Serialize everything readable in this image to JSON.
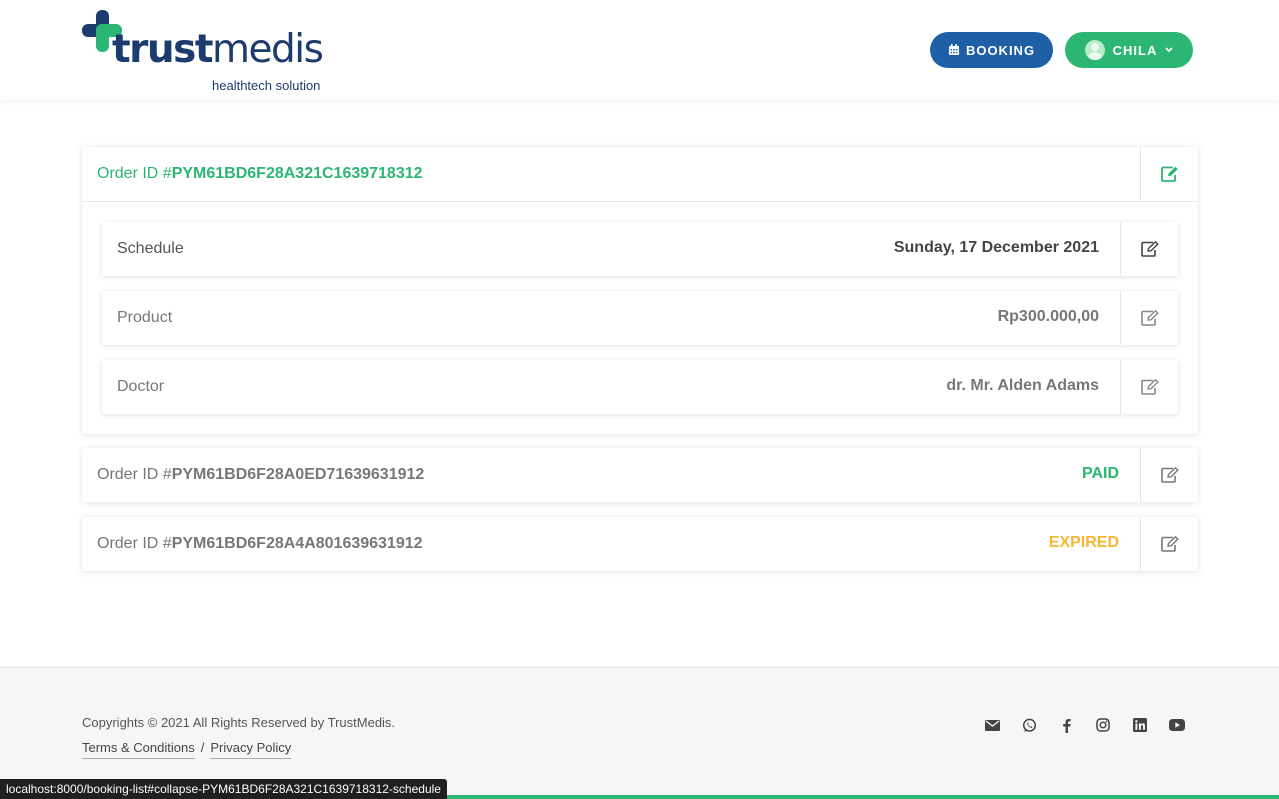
{
  "header": {
    "logo_text_bold": "trust",
    "logo_text_light": "medis",
    "logo_tagline": "healthtech solution",
    "booking_label": "BOOKING",
    "user_label": "CHILA"
  },
  "orders": [
    {
      "prefix": "Order ID #",
      "id": "PYM61BD6F28A321C1639718312",
      "details": {
        "schedule_label": "Schedule",
        "schedule_value": "Sunday, 17 December 2021",
        "product_label": "Product",
        "product_value": "Rp300.000,00",
        "doctor_label": "Doctor",
        "doctor_value": "dr. Mr. Alden Adams"
      }
    },
    {
      "prefix": "Order ID #",
      "id": "PYM61BD6F28A0ED71639631912",
      "status": "PAID"
    },
    {
      "prefix": "Order ID #",
      "id": "PYM61BD6F28A4A801639631912",
      "status": "EXPIRED"
    }
  ],
  "footer": {
    "copyright": "Copyrights © 2021 All Rights Reserved by TrustMedis.",
    "terms": "Terms & Conditions",
    "separator": "/",
    "privacy": "Privacy Policy",
    "socials": [
      "mail-icon",
      "whatsapp-icon",
      "facebook-icon",
      "instagram-icon",
      "linkedin-icon",
      "youtube-icon"
    ]
  },
  "statusbar": "localhost:8000/booking-list#collapse-PYM61BD6F28A321C1639718312-schedule",
  "colors": {
    "green": "#2bb673",
    "blue": "#1f5fa6",
    "amber": "#f5b731",
    "navy": "#1d3c6e"
  }
}
